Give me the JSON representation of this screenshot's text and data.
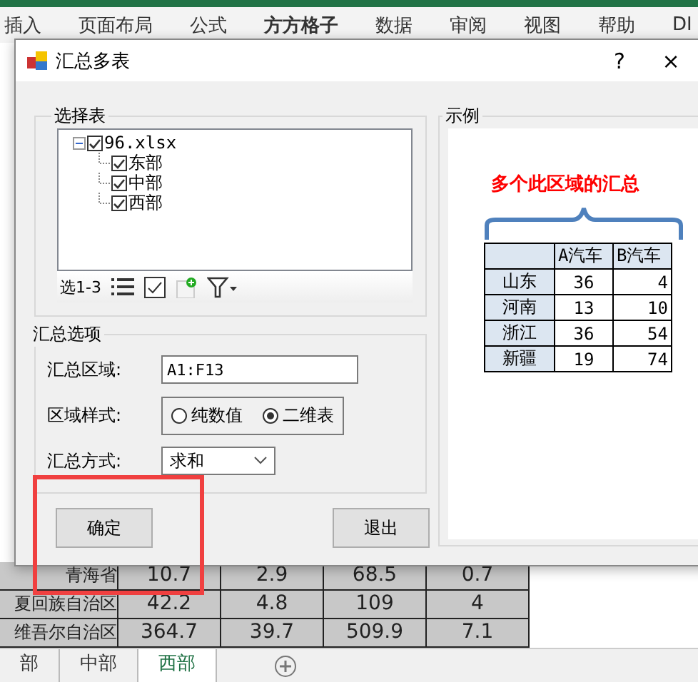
{
  "annotations": [
    {
      "kind": "box"
    }
  ],
  "ribbon_tabs": [
    {
      "label": "插入",
      "selected": false
    },
    {
      "label": "页面布局",
      "selected": false
    },
    {
      "label": "公式",
      "selected": false
    },
    {
      "label": "方方格子",
      "selected": true
    },
    {
      "label": "数据",
      "selected": false
    },
    {
      "label": "审阅",
      "selected": false
    },
    {
      "label": "视图",
      "selected": false
    },
    {
      "label": "帮助",
      "selected": false
    },
    {
      "label": "DI",
      "selected": false
    }
  ],
  "sheet_rows": [
    [
      "青海省",
      "10.7",
      "2.9",
      "68.5",
      "0.7"
    ],
    [
      "夏回族自治区",
      "42.2",
      "4.8",
      "109",
      "4"
    ],
    [
      "维吾尔自治区",
      "364.7",
      "39.7",
      "509.9",
      "7.1"
    ]
  ],
  "sheet_tabs": [
    {
      "label": "部",
      "selected": false
    },
    {
      "label": "中部",
      "selected": false
    },
    {
      "label": "西部",
      "selected": true
    }
  ],
  "dialog": {
    "title": "汇总多表",
    "help": "?",
    "close": "×",
    "select_group": {
      "title": "选择表",
      "tree": [
        {
          "label": "96.xlsx",
          "checked": true,
          "expanded": true,
          "children": [
            {
              "label": "东部",
              "checked": true
            },
            {
              "label": "中部",
              "checked": true
            },
            {
              "label": "西部",
              "checked": true
            }
          ]
        }
      ],
      "selection_label": "选1-3"
    },
    "options_group": {
      "title": "汇总选项",
      "range_label": "汇总区域:",
      "range_value": "A1:F13",
      "style_label": "区域样式:",
      "style_options": [
        {
          "label": "纯数值",
          "selected": false
        },
        {
          "label": "二维表",
          "selected": true
        }
      ],
      "method_label": "汇总方式:",
      "method_value": "求和"
    },
    "buttons": [
      {
        "label": "确定"
      },
      {
        "label": "退出"
      }
    ],
    "example_group": {
      "title": "示例",
      "caption": "多个此区域的汇总",
      "columns": [
        "",
        "A汽车",
        "B汽车"
      ],
      "rows": [
        [
          "山东",
          "36",
          "4"
        ],
        [
          "河南",
          "13",
          "10"
        ],
        [
          "浙江",
          "36",
          "54"
        ],
        [
          "新疆",
          "19",
          "74"
        ]
      ]
    }
  }
}
